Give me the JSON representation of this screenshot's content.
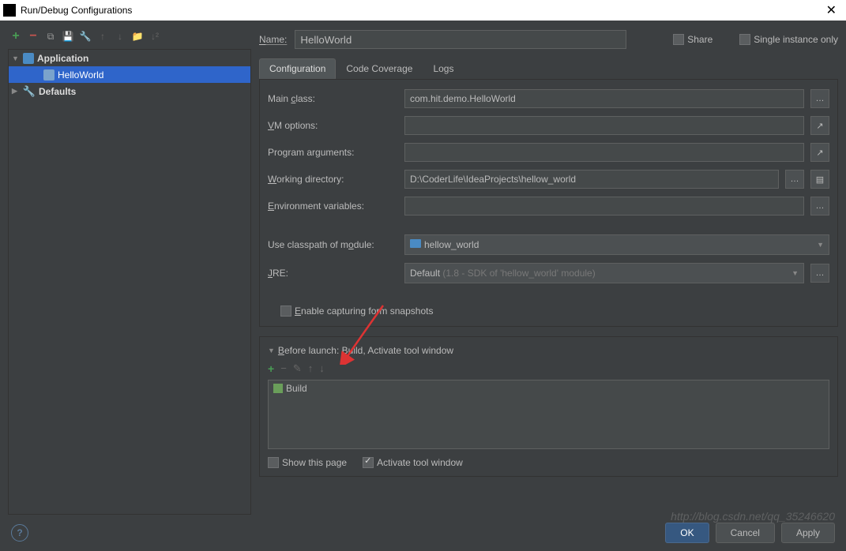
{
  "window": {
    "title": "Run/Debug Configurations"
  },
  "sidebar": {
    "items": [
      {
        "label": "Application",
        "bold": true,
        "expanded": true
      },
      {
        "label": "HelloWorld",
        "indent": 2,
        "selected": true
      },
      {
        "label": "Defaults",
        "bold": true,
        "expanded": false,
        "wrench": true
      }
    ]
  },
  "name": {
    "label": "Name:",
    "value": "HelloWorld"
  },
  "share": {
    "label": "Share"
  },
  "single": {
    "label": "Single instance only"
  },
  "tabs": [
    {
      "label": "Configuration",
      "active": true
    },
    {
      "label": "Code Coverage"
    },
    {
      "label": "Logs"
    }
  ],
  "fields": {
    "main_class": {
      "label": "Main class:",
      "value": "com.hit.demo.HelloWorld"
    },
    "vm_options": {
      "label": "VM options:",
      "value": ""
    },
    "program_args": {
      "label": "Program arguments:",
      "value": ""
    },
    "working_dir": {
      "label": "Working directory:",
      "value": "D:\\CoderLife\\IdeaProjects\\hellow_world"
    },
    "env_vars": {
      "label": "Environment variables:",
      "value": ""
    },
    "classpath": {
      "label": "Use classpath of module:",
      "value": "hellow_world"
    },
    "jre": {
      "label": "JRE:",
      "value": "Default",
      "hint": "(1.8 - SDK of 'hellow_world' module)"
    },
    "capture": {
      "label": "Enable capturing form snapshots"
    }
  },
  "before_launch": {
    "header": "Before launch: Build, Activate tool window",
    "items": [
      {
        "label": "Build"
      }
    ],
    "show_page": "Show this page",
    "activate": "Activate tool window"
  },
  "buttons": {
    "ok": "OK",
    "cancel": "Cancel",
    "apply": "Apply"
  },
  "watermark": "http://blog.csdn.net/qq_35246620"
}
